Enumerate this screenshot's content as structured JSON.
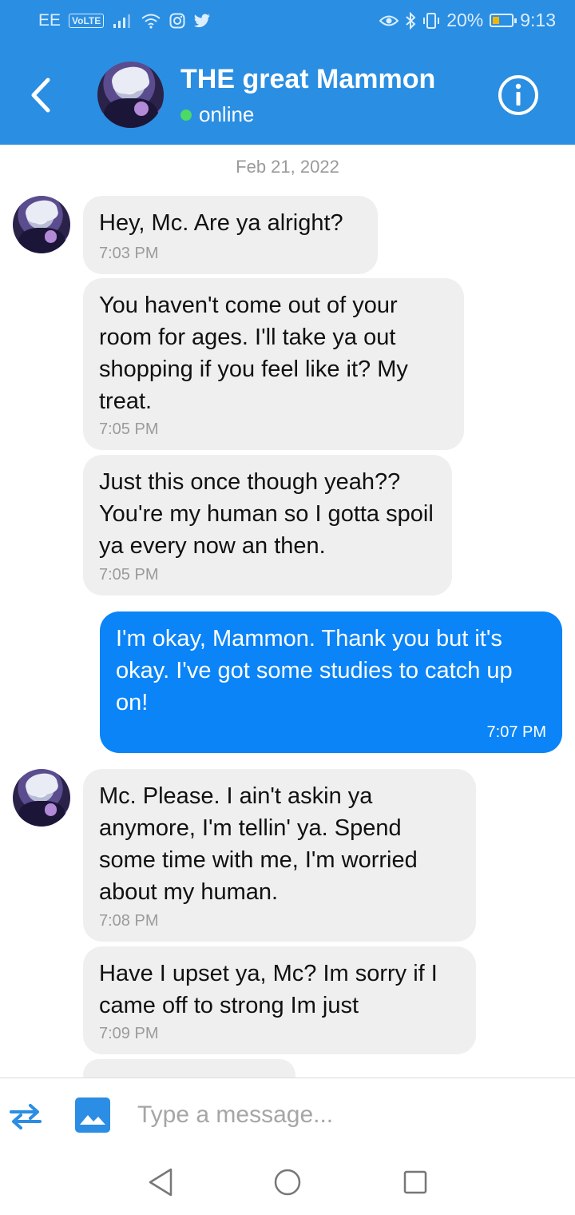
{
  "status_bar": {
    "carrier": "EE",
    "volte": "VoLTE",
    "battery": "20%",
    "time": "9:13"
  },
  "header": {
    "contact_name": "THE great Mammon",
    "status": "online"
  },
  "chat": {
    "date": "Feb 21, 2022",
    "messages": [
      {
        "direction": "in",
        "text": "Hey, Mc. Are ya alright?",
        "time": "7:03 PM"
      },
      {
        "direction": "in",
        "text": "You haven't come out of your room for ages. I'll take ya out shopping if you feel like it? My treat.",
        "time": "7:05 PM"
      },
      {
        "direction": "in",
        "text": "Just this once though yeah?? You're my human so I gotta spoil ya every now an then.",
        "time": "7:05 PM"
      },
      {
        "direction": "out",
        "text": "I'm okay, Mammon. Thank you but it's okay. I've got some studies to catch up on!",
        "time": "7:07 PM"
      },
      {
        "direction": "in",
        "text": "Mc. Please. I ain't askin ya anymore, I'm tellin' ya. Spend some time with me, I'm worried about my human.",
        "time": "7:08 PM"
      },
      {
        "direction": "in",
        "text": "Have I upset ya, Mc? Im sorry if I came off to strong Im just",
        "time": "7:09 PM"
      }
    ]
  },
  "composer": {
    "placeholder": "Type a message..."
  },
  "colors": {
    "header": "#2a8ee2",
    "outgoing_bubble": "#0a84f7",
    "incoming_bubble": "#efefef",
    "online_dot": "#4cd964"
  },
  "icons": [
    "back-arrow-icon",
    "info-icon",
    "swap-icon",
    "image-icon",
    "nav-back-icon",
    "nav-home-icon",
    "nav-recent-icon"
  ]
}
